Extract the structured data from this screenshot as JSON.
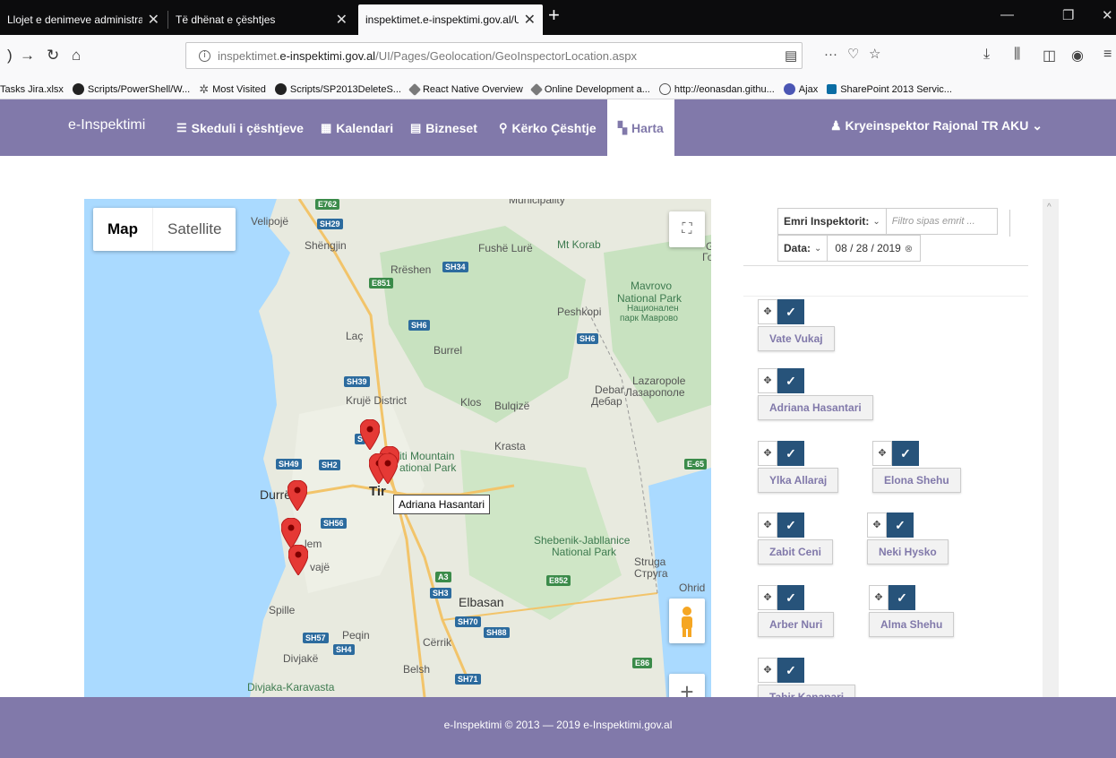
{
  "browser": {
    "tabs": [
      {
        "label": "Llojet e denimeve administrativ",
        "active": false
      },
      {
        "label": "Të dhënat e çështjes",
        "active": false
      },
      {
        "label": "inspektimet.e-inspektimi.gov.al/UI/",
        "active": true
      }
    ],
    "url_prefix": "inspektimet.",
    "url_domain": "e-inspektimi.gov.al",
    "url_path": "/UI/Pages/Geolocation/GeoInspectorLocation.aspx",
    "bookmarks": [
      {
        "label": "Tasks Jira.xlsx",
        "icon": "none"
      },
      {
        "label": "Scripts/PowerShell/W...",
        "icon": "github-icon"
      },
      {
        "label": "Most Visited",
        "icon": "gear-icon"
      },
      {
        "label": "Scripts/SP2013DeleteS...",
        "icon": "github-icon"
      },
      {
        "label": "React Native Overview",
        "icon": "react-icon"
      },
      {
        "label": "Online Development a...",
        "icon": "react-icon"
      },
      {
        "label": "http://eonasdan.githu...",
        "icon": "globe-icon"
      },
      {
        "label": "Ajax",
        "icon": "ajax-icon"
      },
      {
        "label": "SharePoint 2013 Servic...",
        "icon": "sharepoint-icon"
      }
    ]
  },
  "site": {
    "brand": "e-Inspektimi",
    "menu": [
      {
        "label": "Skeduli i çështjeve",
        "icon": "☰"
      },
      {
        "label": "Kalendari",
        "icon": "▦"
      },
      {
        "label": "Bizneset",
        "icon": "▤"
      },
      {
        "label": "Kërko Çështje",
        "icon": "⚲"
      },
      {
        "label": "Harta",
        "icon": "▚"
      }
    ],
    "user": "Kryeinspektor Rajonal TR AKU"
  },
  "map": {
    "type_map": "Map",
    "type_satellite": "Satellite",
    "tooltip": "Adriana Hasantari",
    "labels": [
      "Velipojë",
      "Shëngjin",
      "Fushë Lurë",
      "Mt Korab",
      "Rrëshen",
      "Mavrovo",
      "National Park",
      "Национален",
      "парк Маврово",
      "Peshkopi",
      "Laç",
      "Burrel",
      "Krujë District",
      "Klos",
      "Bulqizë",
      "Debar",
      "Дебар",
      "Lazaropole",
      "Лазарополе",
      "Krasta",
      "iti Mountain",
      "ational Park",
      "Durrë",
      "Tir",
      "lem",
      "vajë",
      "Shebenik-Jabllanice",
      "National Park",
      "Struga",
      "Струга",
      "Ohrid",
      "Elbasan",
      "Spille",
      "Peqin",
      "Cërrik",
      "Divjakë",
      "Belsh",
      "Divjaka-Karavasta",
      "Municipality",
      "G",
      "Го"
    ],
    "roads": [
      "E762",
      "SH29",
      "SH34",
      "E851",
      "SH6",
      "SH6",
      "SH39",
      "S",
      "SH49",
      "SH2",
      "SH56",
      "E-65",
      "A3",
      "SH3",
      "E852",
      "SH70",
      "SH88",
      "SH57",
      "SH4",
      "E86",
      "SH71"
    ]
  },
  "panel": {
    "inspector_filter_label": "Emri Inspektorit:",
    "inspector_filter_placeholder": "Filtro sipas emrit ...",
    "date_label": "Data:",
    "date_value": "08 / 28 / 2019",
    "inspectors": [
      "Vate Vukaj",
      "Adriana Hasantari",
      "Ylka Allaraj",
      "Elona Shehu",
      "Zabit Ceni",
      "Neki Hysko",
      "Arber Nuri",
      "Alma Shehu",
      "Tahir Kanapari"
    ]
  },
  "footer": {
    "text": "e-Inspektimi © 2013 — 2019   e-Inspektimi.gov.al"
  },
  "colors": {
    "brand": "#8179aa",
    "check": "#27537a",
    "marker": "#e53935"
  }
}
